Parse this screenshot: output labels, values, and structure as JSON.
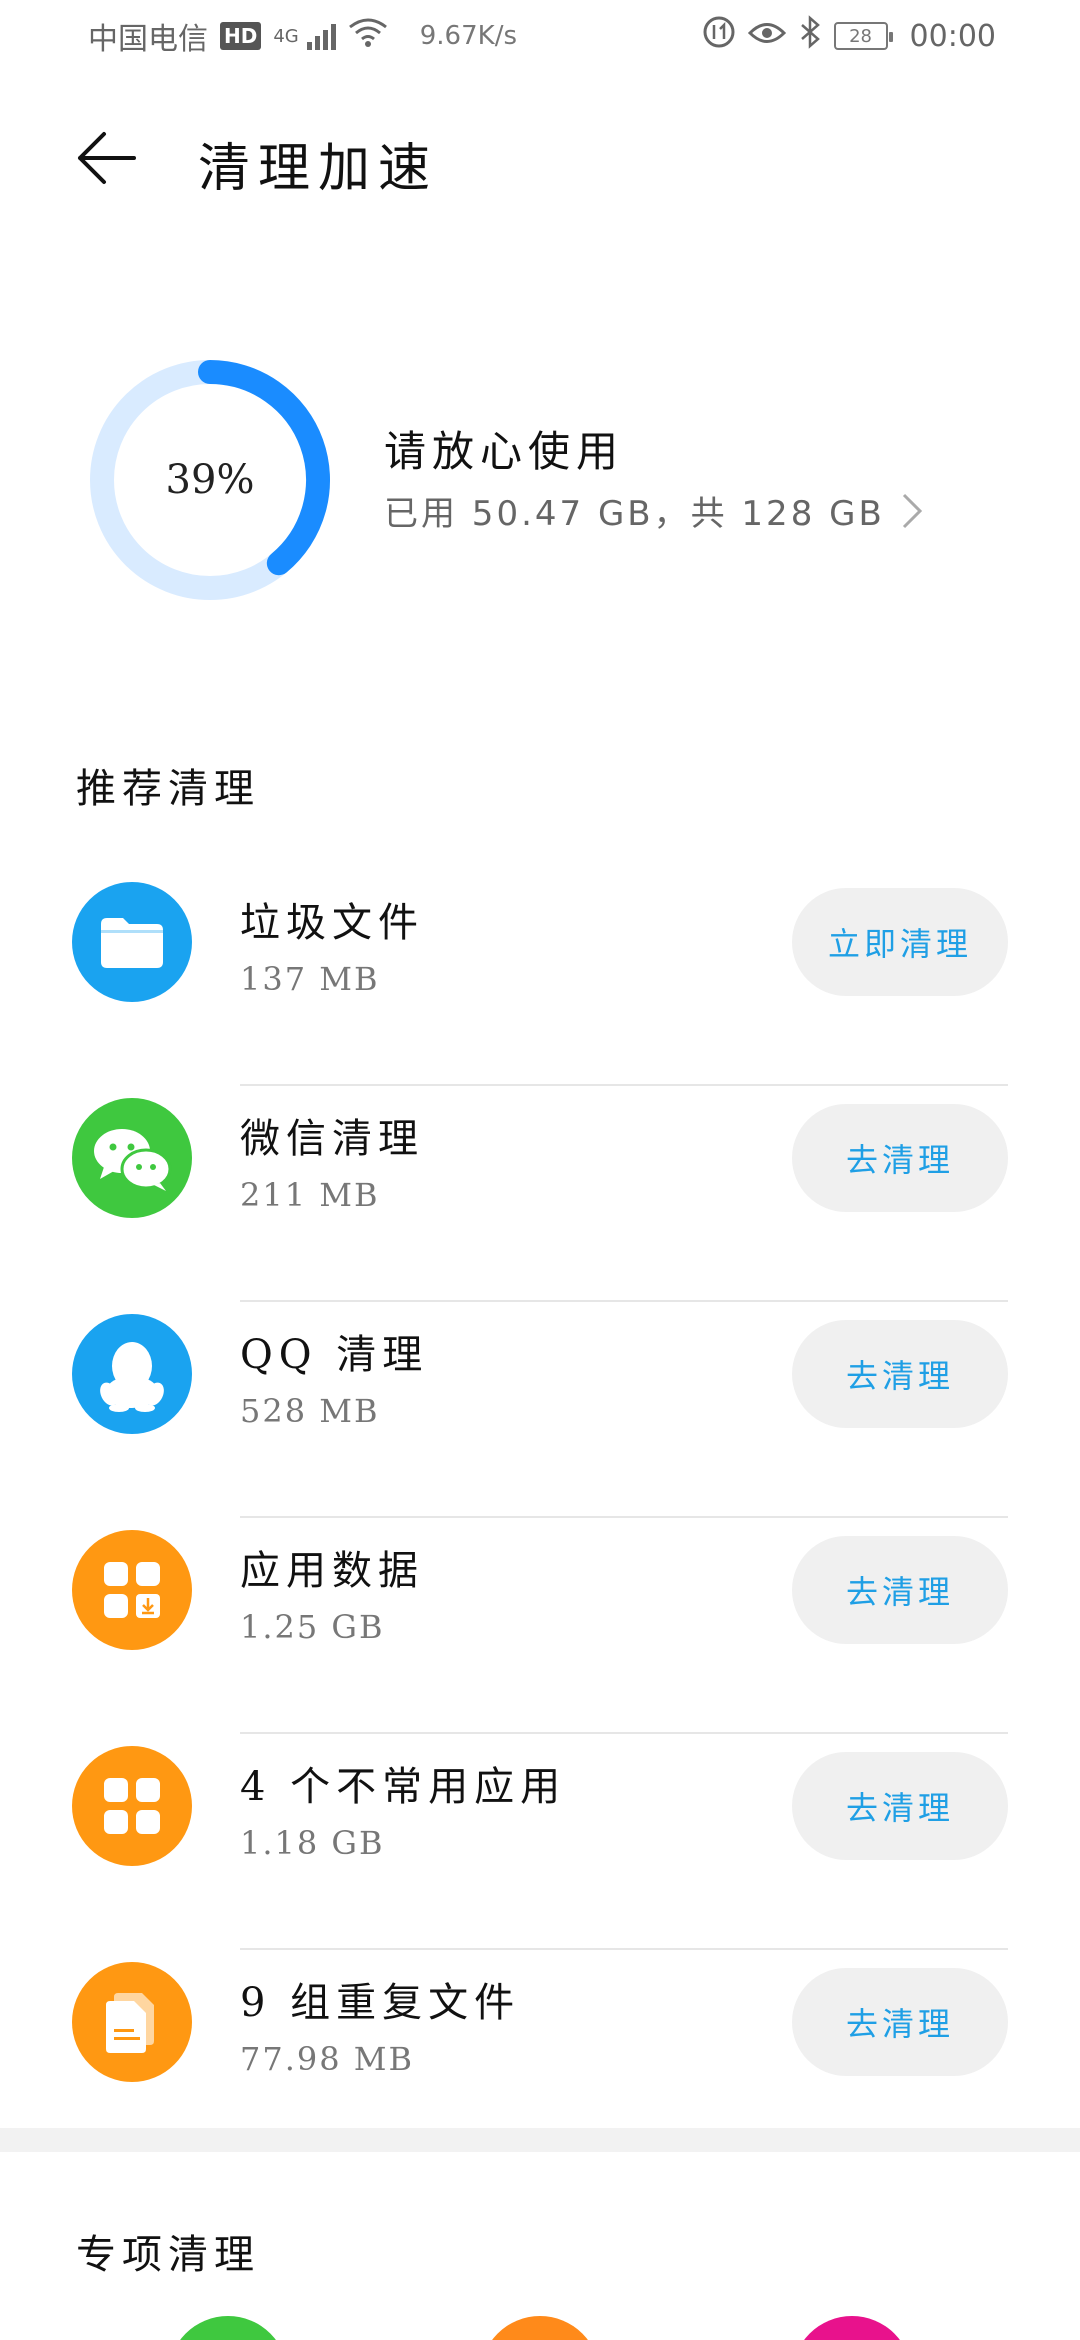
{
  "status_bar": {
    "carrier": "中国电信",
    "hd": "HD",
    "network": "4G",
    "speed": "9.67K/s",
    "battery": "28",
    "time": "00:00"
  },
  "app_bar": {
    "title": "清理加速"
  },
  "storage": {
    "percent_label": "39%",
    "percent": 0.39,
    "headline": "请放心使用",
    "usage": "已用 50.47 GB，共 128 GB",
    "ring_color": "#1a8cff",
    "ring_track": "#d9ebff"
  },
  "recommended": {
    "header": "推荐清理",
    "items": [
      {
        "name": "垃圾文件",
        "size": "137 MB",
        "action": "立即清理",
        "icon": "folder-icon",
        "color": "#1aa3f0"
      },
      {
        "name": "微信清理",
        "size": "211 MB",
        "action": "去清理",
        "icon": "wechat-icon",
        "color": "#3fc83f"
      },
      {
        "name": "QQ 清理",
        "size": "528 MB",
        "action": "去清理",
        "icon": "qq-penguin-icon",
        "color": "#1aa3f0"
      },
      {
        "name": "应用数据",
        "size": "1.25 GB",
        "action": "去清理",
        "icon": "app-data-icon",
        "color": "#ff9812"
      },
      {
        "name": "4 个不常用应用",
        "size": "1.18 GB",
        "action": "去清理",
        "icon": "apps-grid-icon",
        "color": "#ff9812"
      },
      {
        "name": "9 组重复文件",
        "size": "77.98 MB",
        "action": "去清理",
        "icon": "duplicate-files-icon",
        "color": "#ff9812"
      }
    ]
  },
  "special": {
    "header": "专项清理"
  }
}
